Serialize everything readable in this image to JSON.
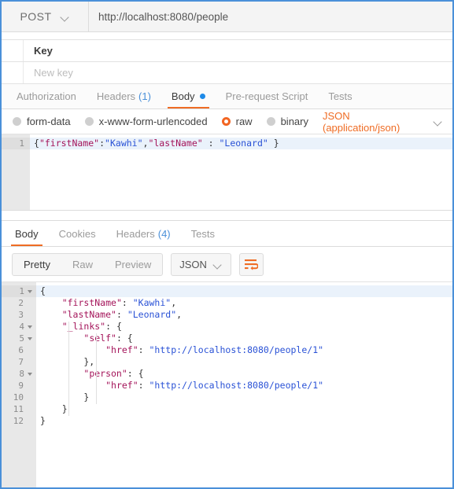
{
  "request": {
    "method": "POST",
    "url": "http://localhost:8080/people",
    "params_table": {
      "header_key": "Key",
      "new_key_placeholder": "New key"
    },
    "tabs": [
      {
        "label": "Authorization",
        "active": false
      },
      {
        "label": "Headers",
        "count": "(1)",
        "active": false
      },
      {
        "label": "Body",
        "active": true,
        "has_dot": true
      },
      {
        "label": "Pre-request Script",
        "active": false
      },
      {
        "label": "Tests",
        "active": false
      }
    ],
    "body_types": [
      {
        "label": "form-data",
        "selected": false
      },
      {
        "label": "x-www-form-urlencoded",
        "selected": false
      },
      {
        "label": "raw",
        "selected": true
      },
      {
        "label": "binary",
        "selected": false
      }
    ],
    "content_type": "JSON (application/json)",
    "editor": {
      "lines": [
        {
          "number": "1",
          "highlighted": true,
          "tokens": [
            {
              "t": "{",
              "c": "jp"
            },
            {
              "t": "\"firstName\"",
              "c": "jk"
            },
            {
              "t": ":",
              "c": "jp"
            },
            {
              "t": "\"Kawhi\"",
              "c": "jv"
            },
            {
              "t": ",",
              "c": "jp"
            },
            {
              "t": "\"lastName\"",
              "c": "jk"
            },
            {
              "t": " : ",
              "c": "jp"
            },
            {
              "t": "\"Leonard\"",
              "c": "jv"
            },
            {
              "t": " }",
              "c": "jp"
            }
          ]
        }
      ]
    }
  },
  "response": {
    "tabs": [
      {
        "label": "Body",
        "active": true
      },
      {
        "label": "Cookies",
        "active": false
      },
      {
        "label": "Headers",
        "count": "(4)",
        "active": false
      },
      {
        "label": "Tests",
        "active": false
      }
    ],
    "view_modes": [
      {
        "label": "Pretty",
        "active": true
      },
      {
        "label": "Raw",
        "active": false
      },
      {
        "label": "Preview",
        "active": false
      }
    ],
    "format": "JSON",
    "wrap_icon": "wrap-lines-icon",
    "body": {
      "lines": [
        {
          "number": "1",
          "fold": true,
          "highlighted": true,
          "tokens": [
            {
              "t": "{",
              "c": "jp"
            }
          ]
        },
        {
          "number": "2",
          "fold": false,
          "highlighted": false,
          "tokens": [
            {
              "t": "    ",
              "c": "jp"
            },
            {
              "t": "\"firstName\"",
              "c": "jk"
            },
            {
              "t": ": ",
              "c": "jp"
            },
            {
              "t": "\"Kawhi\"",
              "c": "jv"
            },
            {
              "t": ",",
              "c": "jp"
            }
          ]
        },
        {
          "number": "3",
          "fold": false,
          "highlighted": false,
          "tokens": [
            {
              "t": "    ",
              "c": "jp"
            },
            {
              "t": "\"lastName\"",
              "c": "jk"
            },
            {
              "t": ": ",
              "c": "jp"
            },
            {
              "t": "\"Leonard\"",
              "c": "jv"
            },
            {
              "t": ",",
              "c": "jp"
            }
          ]
        },
        {
          "number": "4",
          "fold": true,
          "highlighted": false,
          "tokens": [
            {
              "t": "    ",
              "c": "jp"
            },
            {
              "t": "\"_links\"",
              "c": "jk"
            },
            {
              "t": ": {",
              "c": "jp"
            }
          ]
        },
        {
          "number": "5",
          "fold": true,
          "highlighted": false,
          "tokens": [
            {
              "t": "        ",
              "c": "jp"
            },
            {
              "t": "\"self\"",
              "c": "jk"
            },
            {
              "t": ": {",
              "c": "jp"
            }
          ]
        },
        {
          "number": "6",
          "fold": false,
          "highlighted": false,
          "tokens": [
            {
              "t": "            ",
              "c": "jp"
            },
            {
              "t": "\"href\"",
              "c": "jk"
            },
            {
              "t": ": ",
              "c": "jp"
            },
            {
              "t": "\"http://localhost:8080/people/1\"",
              "c": "jv"
            }
          ]
        },
        {
          "number": "7",
          "fold": false,
          "highlighted": false,
          "tokens": [
            {
              "t": "        },",
              "c": "jp"
            }
          ]
        },
        {
          "number": "8",
          "fold": true,
          "highlighted": false,
          "tokens": [
            {
              "t": "        ",
              "c": "jp"
            },
            {
              "t": "\"person\"",
              "c": "jk"
            },
            {
              "t": ": {",
              "c": "jp"
            }
          ]
        },
        {
          "number": "9",
          "fold": false,
          "highlighted": false,
          "tokens": [
            {
              "t": "            ",
              "c": "jp"
            },
            {
              "t": "\"href\"",
              "c": "jk"
            },
            {
              "t": ": ",
              "c": "jp"
            },
            {
              "t": "\"http://localhost:8080/people/1\"",
              "c": "jv"
            }
          ]
        },
        {
          "number": "10",
          "fold": false,
          "highlighted": false,
          "tokens": [
            {
              "t": "        }",
              "c": "jp"
            }
          ]
        },
        {
          "number": "11",
          "fold": false,
          "highlighted": false,
          "tokens": [
            {
              "t": "    }",
              "c": "jp"
            }
          ]
        },
        {
          "number": "12",
          "fold": false,
          "highlighted": false,
          "tokens": [
            {
              "t": "}",
              "c": "jp"
            }
          ]
        }
      ]
    }
  },
  "colors": {
    "accent_orange": "#ef6c24",
    "accent_blue": "#1e8ae8",
    "json_key": "#a4145a",
    "json_value": "#2a52d6",
    "window_border": "#4a90d9"
  }
}
